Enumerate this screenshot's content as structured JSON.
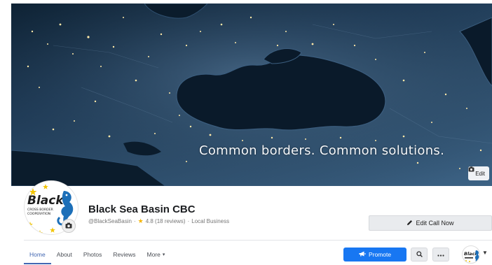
{
  "cover": {
    "tagline": "Common borders. Common solutions.",
    "edit_label": "Edit"
  },
  "profile": {
    "name": "Black Sea Basin CBC",
    "handle": "@BlackSeaBasin",
    "separator": "·",
    "rating": "4.8 (18 reviews)",
    "category": "Local Business",
    "logo_text": "Black",
    "logo_subtext": "CROSS BORDER COOPERATION"
  },
  "actions": {
    "call_now_label": "Edit Call Now",
    "promote_label": "Promote"
  },
  "tabs": [
    {
      "label": "Home",
      "active": true
    },
    {
      "label": "About",
      "active": false
    },
    {
      "label": "Photos",
      "active": false
    },
    {
      "label": "Reviews",
      "active": false
    },
    {
      "label": "More",
      "active": false,
      "caret": "▾"
    }
  ],
  "icons": {
    "camera": "camera-icon",
    "pencil": "pencil-icon",
    "megaphone": "megaphone-icon",
    "search": "search-icon",
    "more": "more-icon",
    "caret": "caret-down-icon"
  },
  "colors": {
    "brand_blue": "#4267b2",
    "promote_blue": "#1877f2",
    "star": "#f5b400",
    "logo_star_yellow": "#f2c400",
    "logo_blue": "#1c6fb8"
  }
}
